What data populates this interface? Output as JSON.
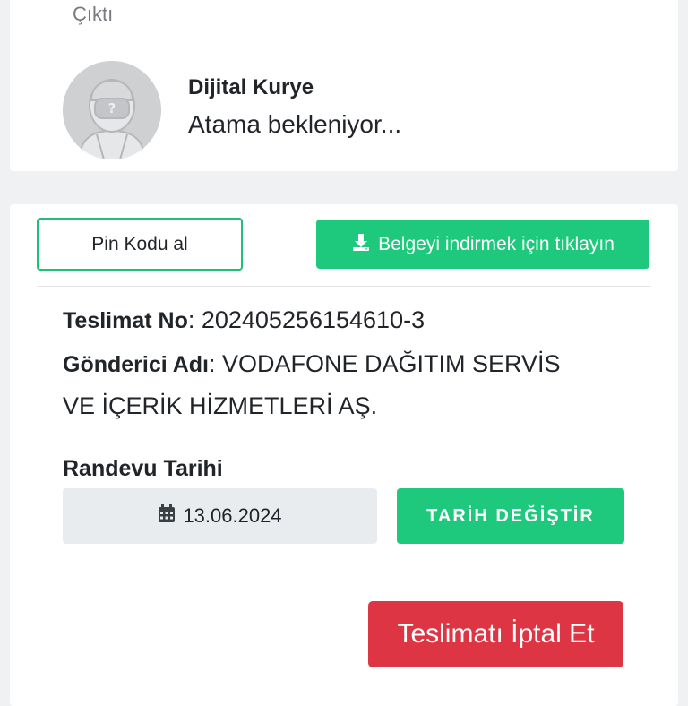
{
  "status_label": "Çıktı",
  "courier": {
    "name": "Dijital Kurye",
    "status": "Atama bekleniyor..."
  },
  "actions": {
    "pin_code_label": "Pin Kodu al",
    "download_label": "Belgeyi indirmek için tıklayın"
  },
  "delivery": {
    "number_label": "Teslimat No",
    "number_value": ": 202405256154610-3",
    "sender_label": "Gönderici Adı",
    "sender_value_line1": ": VODAFONE DAĞITIM SERVİS",
    "sender_value_line2": "VE İÇERİK HİZMETLERİ AŞ."
  },
  "appointment": {
    "title": "Randevu Tarihi",
    "date": "13.06.2024",
    "change_label": "TARİH DEĞİŞTİR"
  },
  "cancel_label": "Teslimatı İptal Et",
  "colors": {
    "accent_green": "#1ec87c",
    "danger_red": "#de3545",
    "background": "#f0f1f3"
  },
  "icons": {
    "avatar": "courier-placeholder-avatar",
    "download": "download-icon",
    "calendar": "calendar-icon"
  }
}
